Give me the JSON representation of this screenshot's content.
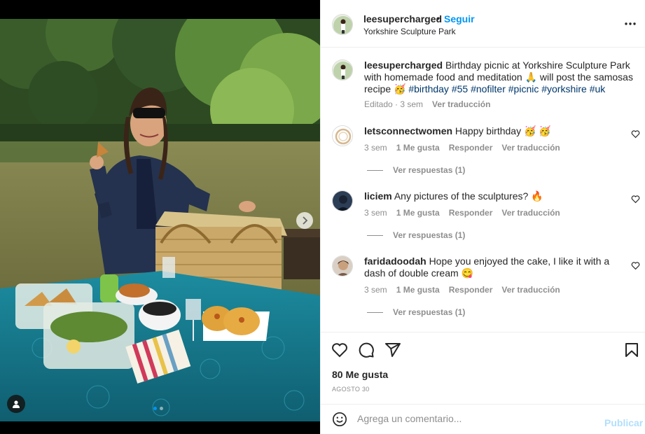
{
  "post": {
    "username": "leesupercharged",
    "follow_label": "Seguir",
    "separator": "•",
    "location": "Yorkshire Sculpture Park"
  },
  "caption": {
    "username": "leesupercharged",
    "text": "Birthday picnic at Yorkshire Sculpture Park with homemade food and meditation 🙏  will post the samosas recipe 🥳",
    "hashtags": "#birthday #55 #nofilter #picnic #yorkshire #uk",
    "edited": "Editado · 3 sem",
    "translate": "Ver traducción"
  },
  "comments": [
    {
      "username": "letsconnectwomen",
      "text": "Happy birthday 🥳 🥳",
      "time": "3 sem",
      "likes": "1 Me gusta",
      "reply": "Responder",
      "translate": "Ver traducción",
      "replies": "Ver respuestas (1)"
    },
    {
      "username": "liciem",
      "text": "Any pictures of the sculptures? 🔥",
      "time": "3 sem",
      "likes": "1 Me gusta",
      "reply": "Responder",
      "translate": "Ver traducción",
      "replies": "Ver respuestas (1)"
    },
    {
      "username": "faridadoodah",
      "text": "Hope you enjoyed the cake, I like it with a dash of double cream 😋",
      "time": "3 sem",
      "likes": "1 Me gusta",
      "reply": "Responder",
      "translate": "Ver traducción",
      "replies": "Ver respuestas (1)"
    }
  ],
  "stats": {
    "likes": "80 Me gusta",
    "date": "AGOSTO 30"
  },
  "composer": {
    "placeholder": "Agrega un comentario...",
    "publish": "Publicar"
  },
  "carousel": {
    "current": 1,
    "total": 2
  },
  "icons": {
    "more": "more-options-icon",
    "next": "chevron-right-icon",
    "tag": "user-tag-icon",
    "like": "heart-icon",
    "comment": "comment-icon",
    "share": "share-icon",
    "save": "bookmark-icon",
    "emoji": "emoji-icon"
  },
  "colors": {
    "accent": "#0095f6",
    "publish_disabled": "#b2dffc",
    "hashtag": "#00376b",
    "muted": "#8e8e8e"
  }
}
